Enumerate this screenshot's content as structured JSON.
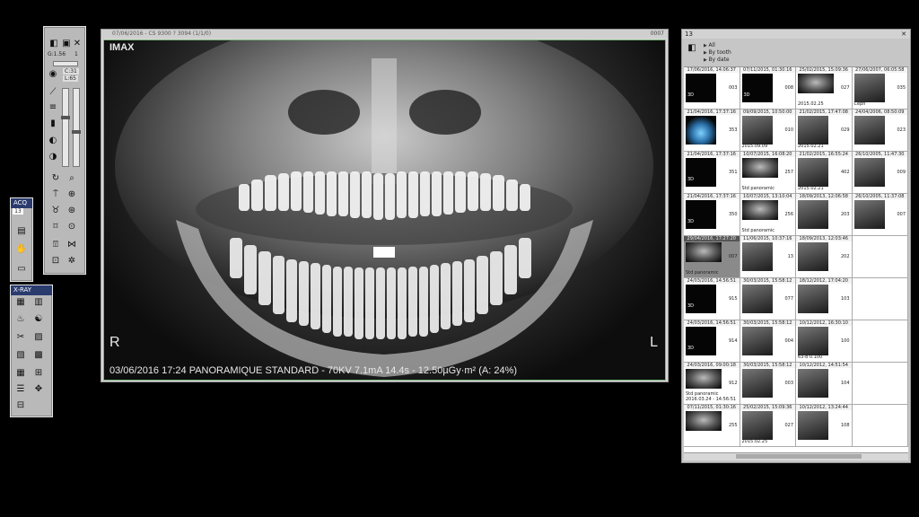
{
  "tools_panel": {
    "gamma": "G:1.56",
    "counter": "1",
    "c_value": "C:31",
    "l_value": "L:65",
    "icons": [
      "contrast-icon",
      "invert-icon",
      "zoom-icon",
      "eye-icon",
      "measure-icon",
      "filter-icon",
      "frame-icon",
      "brightness-icon",
      "sharpen-icon",
      "rotate-icon",
      "magnifier-icon",
      "implant-icon",
      "tooth-icon",
      "annotation-icon",
      "crop-icon",
      "settings-icon"
    ]
  },
  "acq_panel": {
    "title": "ACQ",
    "counter": "13",
    "icons": [
      "document-icon",
      "hand-icon",
      "scanner-icon"
    ]
  },
  "xray_panel": {
    "title": "X-RAY",
    "icons": [
      "teeth-grid-icon",
      "panoramic-icon",
      "sensor-icon",
      "cephalometric-icon",
      "tool-icon",
      "bitewing-icon",
      "layout-icon",
      "tooth-layout-icon",
      "grid-icon",
      "move-icon",
      "stack-icon"
    ]
  },
  "viewer": {
    "title": "07/06/2016 - CS 9300 ? 3094 (1/1/0)",
    "window_code": "0007",
    "brand": "IMAX",
    "right_marker": "R",
    "left_marker": "L",
    "caption": "03/06/2016 17:24 PANORAMIQUE STANDARD - 70KV 7.1mA 14.4s - 12.50µGy·m² (A: 24%)"
  },
  "gallery": {
    "title": "13",
    "filters": [
      "All",
      "By tooth",
      "By date"
    ],
    "items": [
      {
        "date": "17/06/2016, 14:06:37",
        "code": "003",
        "type": "3d",
        "badge": "3D"
      },
      {
        "date": "07/11/2015, 01:30:16",
        "code": "008",
        "type": "3d",
        "badge": "3D"
      },
      {
        "date": "25/02/2015, 15:09:36",
        "code": "027",
        "type": "pano",
        "sub": "2015.02.25"
      },
      {
        "date": "27/06/2007, 06:05:58",
        "code": "035",
        "type": "xray",
        "sub": "Ceph"
      },
      {
        "date": "21/04/2016, 17:37:16",
        "code": "353",
        "type": "model"
      },
      {
        "date": "09/09/2015, 10:50:00",
        "code": "010",
        "type": "xray",
        "sub": "2015.09.09"
      },
      {
        "date": "21/02/2015, 17:47:08",
        "code": "029",
        "type": "xray",
        "sub": "2015.02.21"
      },
      {
        "date": "24/04/2006, 08:50:09",
        "code": "023",
        "type": "xray"
      },
      {
        "date": "21/04/2016, 17:37:16",
        "code": "351",
        "type": "3d",
        "badge": "3D"
      },
      {
        "date": "10/07/2015, 16:08:20",
        "code": "257",
        "type": "pano",
        "sub": "Std panoramic"
      },
      {
        "date": "21/02/2015, 16:55:24",
        "code": "402",
        "type": "xray",
        "sub": "2015.02.21"
      },
      {
        "date": "26/10/2005, 11:47:30",
        "code": "009",
        "type": "xray"
      },
      {
        "date": "21/04/2016, 17:37:16",
        "code": "350",
        "type": "3d",
        "badge": "3D"
      },
      {
        "date": "10/07/2015, 13:10:04",
        "code": "256",
        "type": "pano",
        "sub": "Std panoramic"
      },
      {
        "date": "18/09/2013, 12:06:58",
        "code": "203",
        "type": "xray"
      },
      {
        "date": "26/10/2005, 11:37:08",
        "code": "007",
        "type": "xray"
      },
      {
        "date": "29/04/2016, 17:27:20",
        "code": "007",
        "type": "pano",
        "sub": "Std panoramic",
        "selected": true
      },
      {
        "date": "11/06/2015, 10:37:16",
        "code": "13",
        "type": "xray"
      },
      {
        "date": "18/09/2013, 12:03:46",
        "code": "202",
        "type": "xray"
      },
      {
        "date": "",
        "code": "",
        "type": "empty"
      },
      {
        "date": "24/03/2016, 14:56:51",
        "code": "915",
        "type": "3d",
        "badge": "3D"
      },
      {
        "date": "30/03/2015, 15:58:12",
        "code": "077",
        "type": "xray"
      },
      {
        "date": "18/12/2012, 17:04:20",
        "code": "103",
        "type": "xray"
      },
      {
        "date": "",
        "code": "",
        "type": "empty"
      },
      {
        "date": "24/03/2016, 14:56:51",
        "code": "914",
        "type": "3d",
        "badge": "3D"
      },
      {
        "date": "30/03/2015, 15:58:12",
        "code": "004",
        "type": "xray"
      },
      {
        "date": "10/12/2012, 16:30:10",
        "code": "100",
        "type": "xray",
        "sub": "63-8  0.100"
      },
      {
        "date": "",
        "code": "",
        "type": "empty"
      },
      {
        "date": "24/03/2016, 09:00:18",
        "code": "912",
        "type": "pano",
        "sub": "Std panoramic 2016.03.24 - 14:56:51"
      },
      {
        "date": "30/03/2015, 15:58:12",
        "code": "003",
        "type": "xray"
      },
      {
        "date": "10/12/2012, 14:51:54",
        "code": "104",
        "type": "xray"
      },
      {
        "date": "",
        "code": "",
        "type": "empty"
      },
      {
        "date": "07/11/2015, 01:30:16",
        "code": "255",
        "type": "pano"
      },
      {
        "date": "25/02/2015, 15:09:36",
        "code": "027",
        "type": "xray",
        "sub": "2015.02.25"
      },
      {
        "date": "10/12/2012, 13:24:44",
        "code": "108",
        "type": "xray"
      },
      {
        "date": "",
        "code": "",
        "type": "empty"
      }
    ]
  }
}
